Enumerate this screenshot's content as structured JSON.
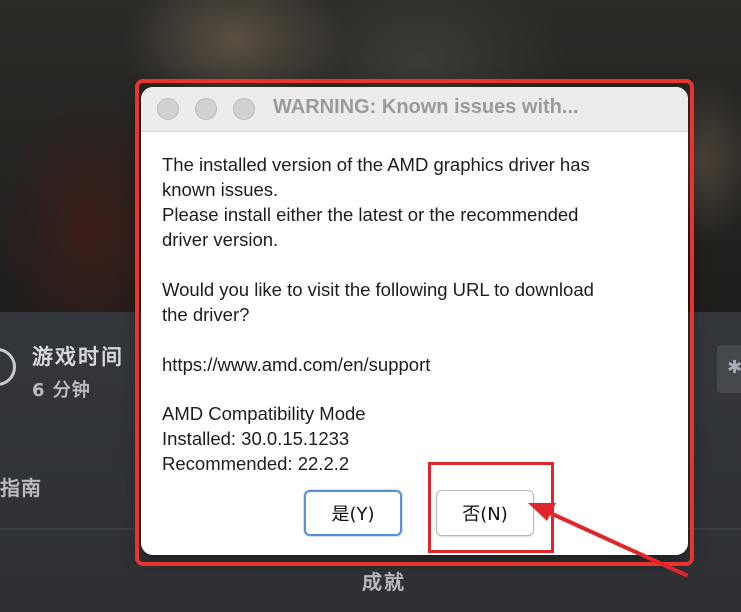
{
  "background": {
    "playtime_label": "游戏时间",
    "playtime_value": "6 分钟",
    "guide_label": "指南",
    "achievements_label": "成就"
  },
  "dialog": {
    "title": "WARNING: Known issues with...",
    "lines": [
      "The installed version of the AMD graphics driver has",
      "known issues.",
      "Please install either the latest or the recommended",
      "driver version.",
      "Would you like to visit the following URL to download",
      "the driver?",
      "https://www.amd.com/en/support",
      "AMD Compatibility Mode",
      "Installed: 30.0.15.1233",
      "Recommended: 22.2.2"
    ],
    "yes_button": "是(Y)",
    "no_button": "否(N)"
  },
  "colors": {
    "annotation_red": "#e8332e",
    "focus_blue": "#5a8fd8"
  }
}
